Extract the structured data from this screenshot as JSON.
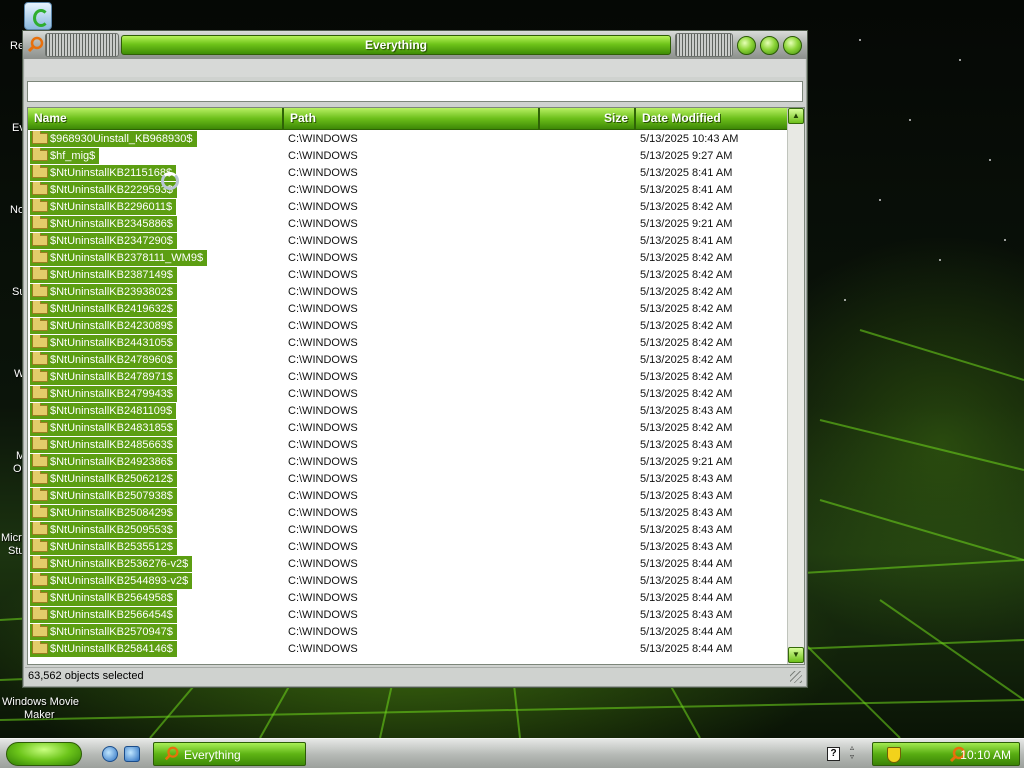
{
  "window": {
    "title": "Everything"
  },
  "search": {
    "value": "",
    "placeholder": ""
  },
  "columns": {
    "name": "Name",
    "path": "Path",
    "size": "Size",
    "date": "Date Modified"
  },
  "rows": [
    {
      "name": "$968930Uinstall_KB968930$",
      "path": "C:\\WINDOWS",
      "date": "5/13/2025 10:43 AM"
    },
    {
      "name": "$hf_mig$",
      "path": "C:\\WINDOWS",
      "date": "5/13/2025 9:27 AM"
    },
    {
      "name": "$NtUninstallKB2115168$",
      "path": "C:\\WINDOWS",
      "date": "5/13/2025 8:41 AM"
    },
    {
      "name": "$NtUninstallKB2229593$",
      "path": "C:\\WINDOWS",
      "date": "5/13/2025 8:41 AM"
    },
    {
      "name": "$NtUninstallKB2296011$",
      "path": "C:\\WINDOWS",
      "date": "5/13/2025 8:42 AM"
    },
    {
      "name": "$NtUninstallKB2345886$",
      "path": "C:\\WINDOWS",
      "date": "5/13/2025 9:21 AM"
    },
    {
      "name": "$NtUninstallKB2347290$",
      "path": "C:\\WINDOWS",
      "date": "5/13/2025 8:41 AM"
    },
    {
      "name": "$NtUninstallKB2378111_WM9$",
      "path": "C:\\WINDOWS",
      "date": "5/13/2025 8:42 AM"
    },
    {
      "name": "$NtUninstallKB2387149$",
      "path": "C:\\WINDOWS",
      "date": "5/13/2025 8:42 AM"
    },
    {
      "name": "$NtUninstallKB2393802$",
      "path": "C:\\WINDOWS",
      "date": "5/13/2025 8:42 AM"
    },
    {
      "name": "$NtUninstallKB2419632$",
      "path": "C:\\WINDOWS",
      "date": "5/13/2025 8:42 AM"
    },
    {
      "name": "$NtUninstallKB2423089$",
      "path": "C:\\WINDOWS",
      "date": "5/13/2025 8:42 AM"
    },
    {
      "name": "$NtUninstallKB2443105$",
      "path": "C:\\WINDOWS",
      "date": "5/13/2025 8:42 AM"
    },
    {
      "name": "$NtUninstallKB2478960$",
      "path": "C:\\WINDOWS",
      "date": "5/13/2025 8:42 AM"
    },
    {
      "name": "$NtUninstallKB2478971$",
      "path": "C:\\WINDOWS",
      "date": "5/13/2025 8:42 AM"
    },
    {
      "name": "$NtUninstallKB2479943$",
      "path": "C:\\WINDOWS",
      "date": "5/13/2025 8:42 AM"
    },
    {
      "name": "$NtUninstallKB2481109$",
      "path": "C:\\WINDOWS",
      "date": "5/13/2025 8:43 AM"
    },
    {
      "name": "$NtUninstallKB2483185$",
      "path": "C:\\WINDOWS",
      "date": "5/13/2025 8:42 AM"
    },
    {
      "name": "$NtUninstallKB2485663$",
      "path": "C:\\WINDOWS",
      "date": "5/13/2025 8:43 AM"
    },
    {
      "name": "$NtUninstallKB2492386$",
      "path": "C:\\WINDOWS",
      "date": "5/13/2025 9:21 AM"
    },
    {
      "name": "$NtUninstallKB2506212$",
      "path": "C:\\WINDOWS",
      "date": "5/13/2025 8:43 AM"
    },
    {
      "name": "$NtUninstallKB2507938$",
      "path": "C:\\WINDOWS",
      "date": "5/13/2025 8:43 AM"
    },
    {
      "name": "$NtUninstallKB2508429$",
      "path": "C:\\WINDOWS",
      "date": "5/13/2025 8:43 AM"
    },
    {
      "name": "$NtUninstallKB2509553$",
      "path": "C:\\WINDOWS",
      "date": "5/13/2025 8:43 AM"
    },
    {
      "name": "$NtUninstallKB2535512$",
      "path": "C:\\WINDOWS",
      "date": "5/13/2025 8:43 AM"
    },
    {
      "name": "$NtUninstallKB2536276-v2$",
      "path": "C:\\WINDOWS",
      "date": "5/13/2025 8:44 AM"
    },
    {
      "name": "$NtUninstallKB2544893-v2$",
      "path": "C:\\WINDOWS",
      "date": "5/13/2025 8:44 AM"
    },
    {
      "name": "$NtUninstallKB2564958$",
      "path": "C:\\WINDOWS",
      "date": "5/13/2025 8:44 AM"
    },
    {
      "name": "$NtUninstallKB2566454$",
      "path": "C:\\WINDOWS",
      "date": "5/13/2025 8:43 AM"
    },
    {
      "name": "$NtUninstallKB2570947$",
      "path": "C:\\WINDOWS",
      "date": "5/13/2025 8:44 AM"
    },
    {
      "name": "$NtUninstallKB2584146$",
      "path": "C:\\WINDOWS",
      "date": "5/13/2025 8:44 AM"
    }
  ],
  "status": {
    "text": "63,562 objects selected"
  },
  "desktop": {
    "labels": [
      "Re",
      "Ev",
      "No",
      "Su",
      "W",
      "M",
      "O",
      "Micro",
      "Stu",
      "Windows Movie",
      "Maker"
    ]
  },
  "taskbar": {
    "task_label": "Everything",
    "clock": "10:10 AM",
    "help_label": "?"
  },
  "colors": {
    "accent": "#6cbf1a",
    "selection": "#5c9e12"
  },
  "icons": {
    "app": "magnifier-icon",
    "folder": "folder-icon",
    "start": "start-orb-icon",
    "ie": "internet-explorer-icon"
  }
}
